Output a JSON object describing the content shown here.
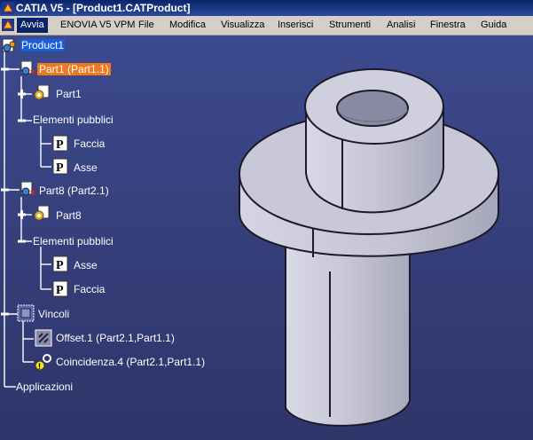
{
  "window": {
    "title": "CATIA V5 - [Product1.CATProduct]"
  },
  "menu": {
    "items": [
      "Avvia",
      "ENOVIA V5 VPM",
      "File",
      "Modifica",
      "Visualizza",
      "Inserisci",
      "Strumenti",
      "Analisi",
      "Finestra",
      "Guida"
    ],
    "active": "Avvia"
  },
  "tree": {
    "root": "Product1",
    "part1_instance": "Part1 (Part1.1)",
    "part1": "Part1",
    "part1_pub": "Elementi pubblici",
    "part1_pub_items": [
      "Faccia",
      "Asse"
    ],
    "part8_instance": "Part8 (Part2.1)",
    "part8": "Part8",
    "part8_pub": "Elementi pubblici",
    "part8_pub_items": [
      "Asse",
      "Faccia"
    ],
    "constraints": "Vincoli",
    "constraint_items": [
      "Offset.1 (Part2.1,Part1.1)",
      "Coincidenza.4 (Part2.1,Part1.1)"
    ],
    "applications": "Applicazioni"
  },
  "colors": {
    "background_top": "#3c4a8e",
    "background_bottom": "#2f356a",
    "part_color": "#c8c8d6",
    "selection_blue": "#1a5fd8",
    "selection_orange": "#f0781e"
  }
}
